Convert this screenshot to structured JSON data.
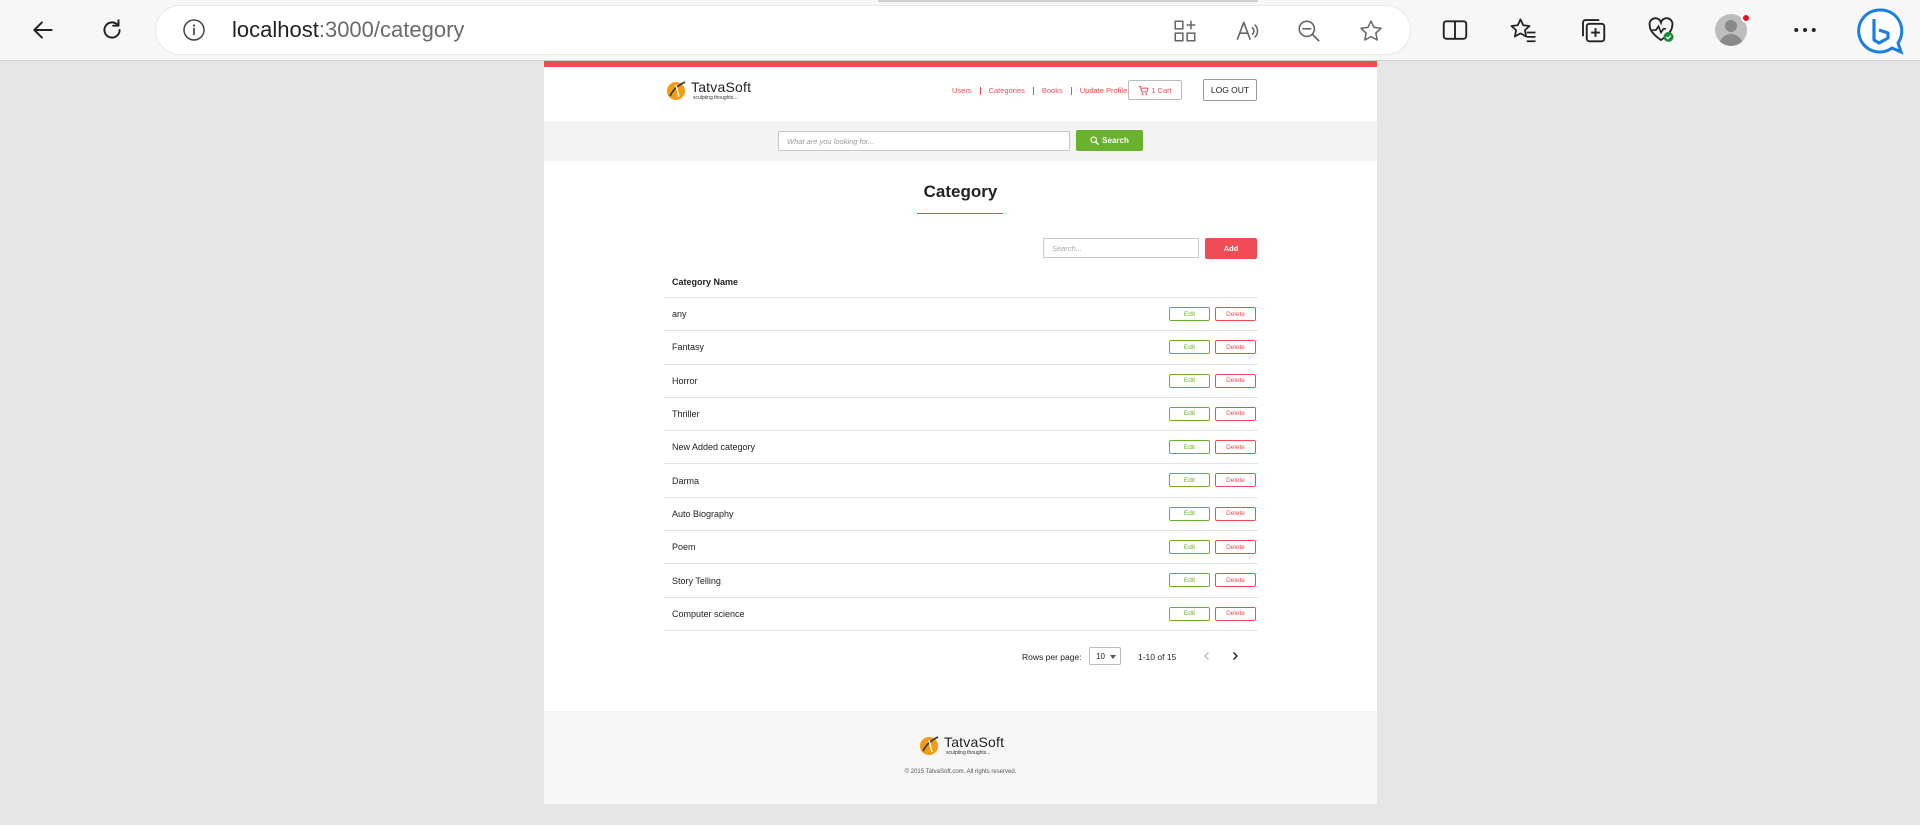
{
  "browser": {
    "url_host": "localhost",
    "url_path": ":3000/category",
    "icons": [
      "back-icon",
      "refresh-icon",
      "site-info-icon",
      "app-available-icon",
      "read-aloud-icon",
      "zoom-out-icon",
      "favorite-star-icon",
      "split-screen-icon",
      "favorites-icon",
      "collections-icon",
      "browser-essentials-icon",
      "profile-icon",
      "more-icon",
      "bing-copilot-icon"
    ]
  },
  "header": {
    "brand": "TatvaSoft",
    "tagline": "sculpting thoughts...",
    "nav": [
      "Users",
      "Categories",
      "Books",
      "Update Profile"
    ],
    "cart_label": "1 Cart",
    "logout_label": "LOG OUT"
  },
  "search": {
    "placeholder": "What are you looking for...",
    "button_label": "Search"
  },
  "main": {
    "title": "Category",
    "filter_placeholder": "Search...",
    "add_label": "Add",
    "column_header": "Category Name",
    "edit_label": "Edit",
    "delete_label": "Delete",
    "rows": [
      "any",
      "Fantasy",
      "Horror",
      "Thriller",
      "New Added category",
      "Darma",
      "Auto Biography",
      "Poem",
      "Story Telling",
      "Computer science"
    ]
  },
  "pagination": {
    "rows_per_page_label": "Rows per page:",
    "rows_per_page_value": "10",
    "range_label": "1-10 of 15"
  },
  "footer": {
    "brand": "TatvaSoft",
    "tagline": "sculpting thoughts...",
    "copyright": "© 2015 TatvaSoft.com. All rights reserved."
  },
  "colors": {
    "accent_red": "#ef4c55",
    "accent_green": "#6ab130",
    "logo_orange": "#f39c12"
  }
}
